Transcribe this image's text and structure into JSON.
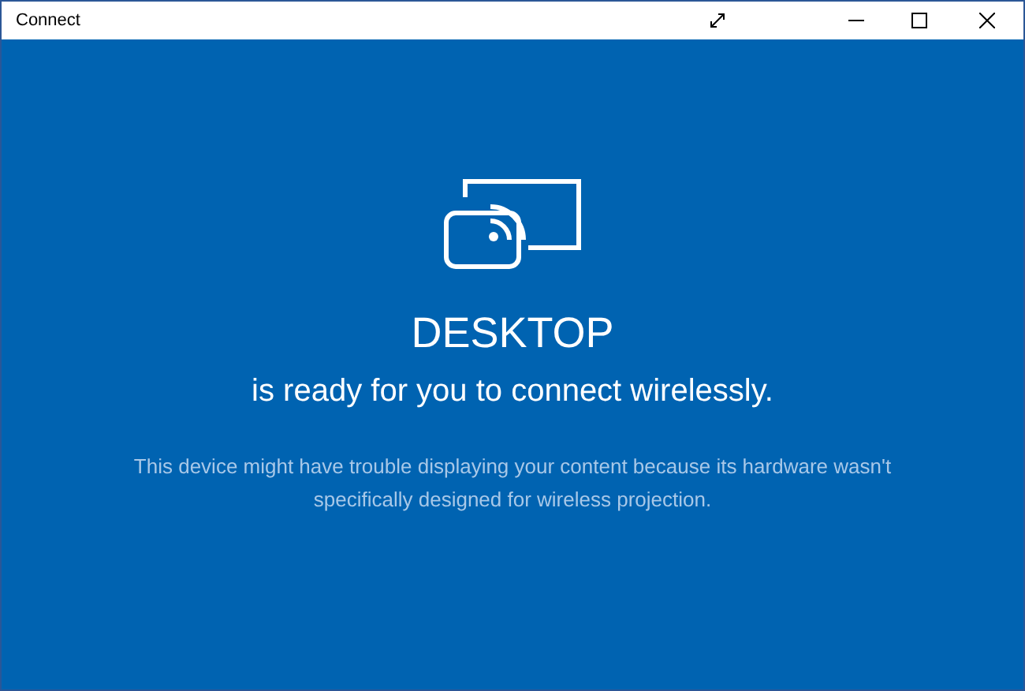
{
  "window": {
    "title": "Connect"
  },
  "content": {
    "device_name": "DESKTOP",
    "status": "is ready for you to connect wirelessly.",
    "warning": "This device might have trouble displaying your content because its hardware wasn't specifically designed for wireless projection."
  }
}
